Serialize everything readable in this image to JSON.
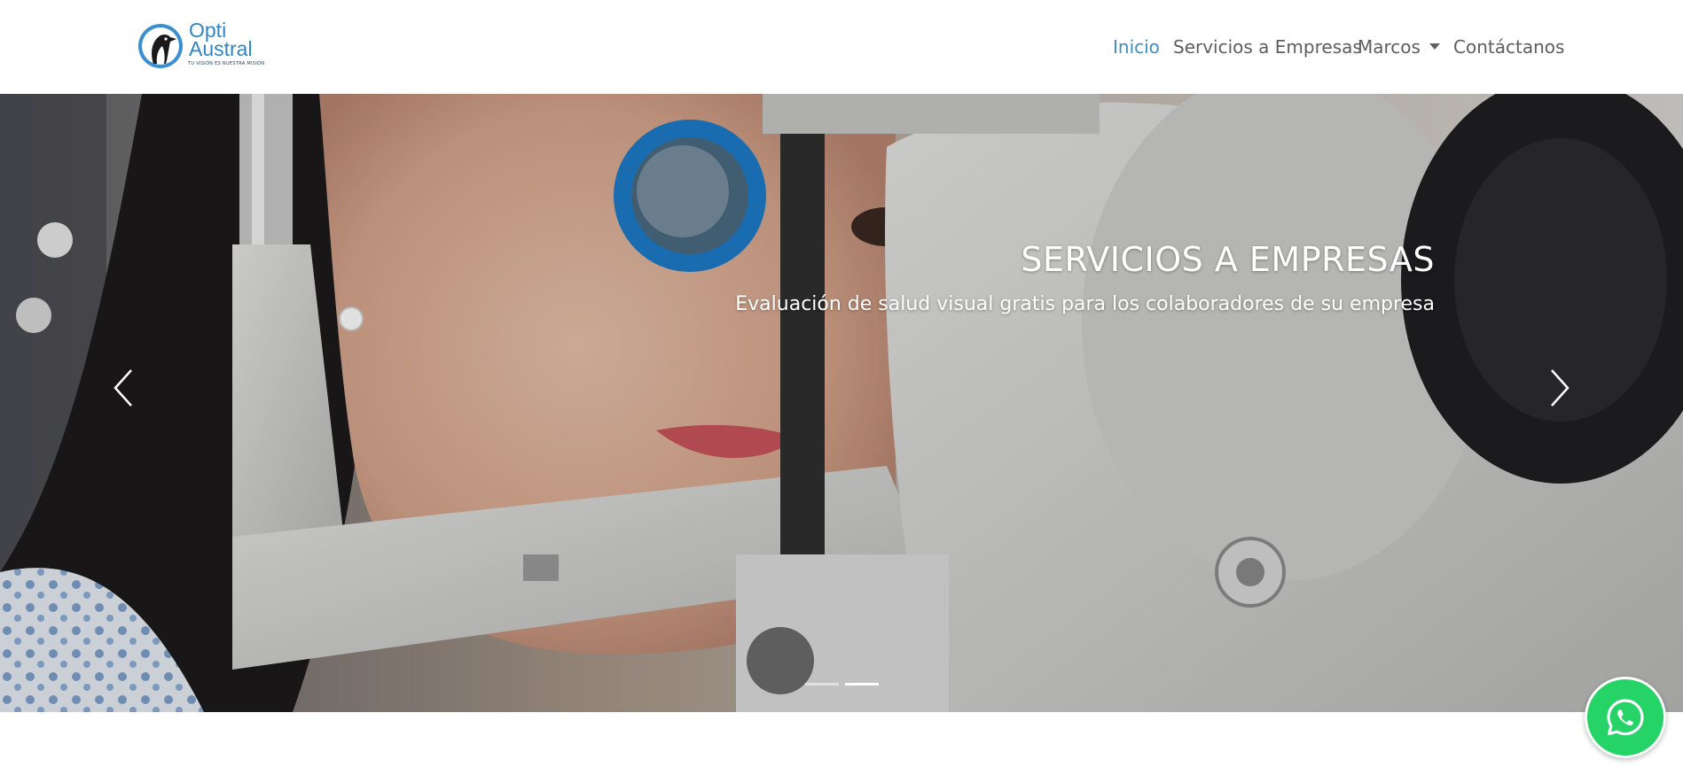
{
  "brand": {
    "line1": "Opti",
    "line2": "Austral",
    "tagline": "TU VISIÓN ES NUESTRA MISIÓN",
    "color": "#2f86c6",
    "icon": "penguin-logo-icon"
  },
  "nav": {
    "items": [
      {
        "label": "Inicio",
        "active": true
      },
      {
        "label": "Servicios a Empresas",
        "active": false
      },
      {
        "label": "Marcos",
        "active": false,
        "dropdown": true
      },
      {
        "label": "Contáctanos",
        "active": false
      }
    ],
    "active_color": "#3f8fc4",
    "text_color": "#5e5e5e"
  },
  "carousel": {
    "title": "SERVICIOS A EMPRESAS",
    "subtitle": "Evaluación de salud visual gratis para los colaboradores de su empresa",
    "prev_icon": "chevron-left-icon",
    "next_icon": "chevron-right-icon",
    "slide_count": 2,
    "active_slide": 2
  },
  "whatsapp": {
    "icon": "whatsapp-icon",
    "color": "#25d366"
  }
}
